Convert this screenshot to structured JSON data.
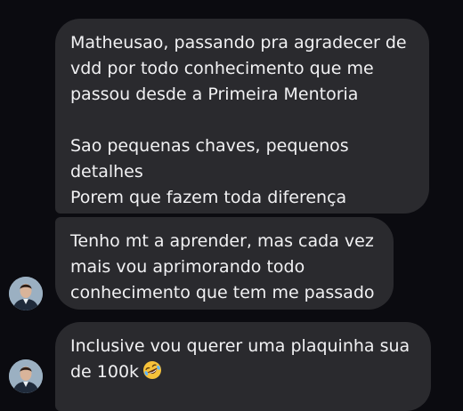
{
  "chat": {
    "messages": [
      {
        "paragraphs": [
          "Matheusao, passando pra agradecer de\nvdd por todo conhecimento que me\npassou desde a Primeira Mentoria",
          "Sao pequenas chaves, pequenos\ndetalhes\nPorem que fazem toda diferença"
        ]
      },
      {
        "paragraphs": [
          "Tenho mt a aprender, mas cada vez\nmais vou aprimorando todo\nconhecimento que tem me passado"
        ]
      },
      {
        "paragraphs": [
          "Inclusive vou querer uma plaquinha sua\nde 100k"
        ],
        "emoji": "rolling-on-the-floor-laughing-icon"
      }
    ]
  },
  "colors": {
    "background": "#0b0b10",
    "bubble": "#2a2a2e",
    "text": "#f1f1f3"
  }
}
